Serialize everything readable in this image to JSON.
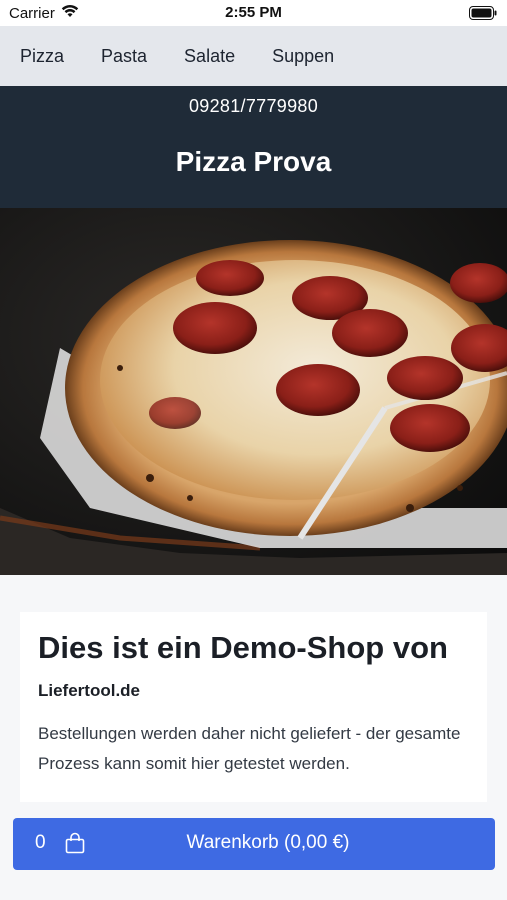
{
  "status_bar": {
    "carrier": "Carrier",
    "time": "2:55 PM"
  },
  "categories": [
    {
      "label": "Pizza"
    },
    {
      "label": "Pasta"
    },
    {
      "label": "Salate"
    },
    {
      "label": "Suppen"
    }
  ],
  "shop": {
    "phone": "09281/7779980",
    "name": "Pizza Prova"
  },
  "intro": {
    "title": "Dies ist ein Demo-Shop von",
    "brand": "Liefertool.de",
    "text": "Bestellungen werden daher nicht geliefert - der gesamte Prozess kann somit hier getestet werden."
  },
  "cart": {
    "count": "0",
    "label": "Warenkorb (0,00 €)"
  },
  "colors": {
    "header_bg": "#1f2b38",
    "nav_bg": "#e4e7ec",
    "accent": "#3e6ae3"
  }
}
